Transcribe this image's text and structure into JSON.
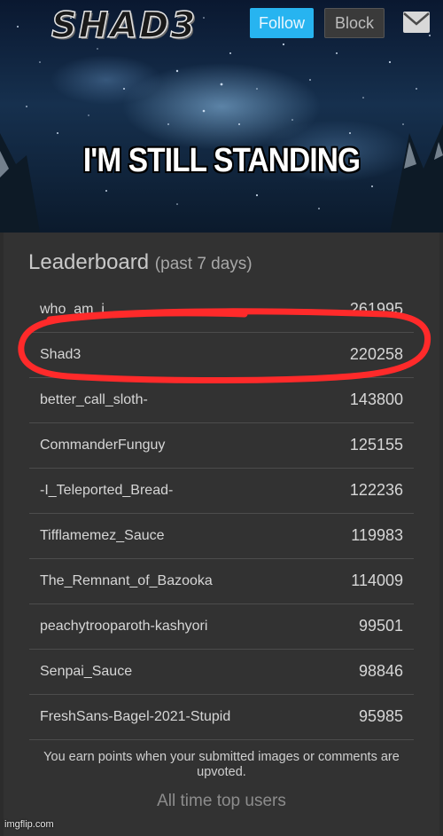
{
  "banner": {
    "logo_text": "SHAD3",
    "follow_label": "Follow",
    "block_label": "Block",
    "mail_icon": "envelope-icon",
    "headline": "I'M STILL STANDING"
  },
  "leaderboard": {
    "title": "Leaderboard",
    "subtitle": "(past 7 days)",
    "highlighted_user": "Shad3",
    "rows": [
      {
        "name": "who_am_i",
        "score": "261995"
      },
      {
        "name": "Shad3",
        "score": "220258"
      },
      {
        "name": "better_call_sloth-",
        "score": "143800"
      },
      {
        "name": "CommanderFunguy",
        "score": "125155"
      },
      {
        "name": "-I_Teleported_Bread-",
        "score": "122236"
      },
      {
        "name": "Tifflamemez_Sauce",
        "score": "119983"
      },
      {
        "name": "The_Remnant_of_Bazooka",
        "score": "114009"
      },
      {
        "name": "peachytrooparoth-kashyori",
        "score": "99501"
      },
      {
        "name": "Senpai_Sauce",
        "score": "98846"
      },
      {
        "name": "FreshSans-Bagel-2021-Stupid",
        "score": "95985"
      }
    ],
    "footer_note": "You earn points when your submitted images or comments are upvoted.",
    "all_time_link": "All time top users"
  },
  "watermark": "imgflip.com",
  "colors": {
    "follow": "#27b4f0",
    "panel": "#323232",
    "highlight_stroke": "#ff2a2a"
  }
}
